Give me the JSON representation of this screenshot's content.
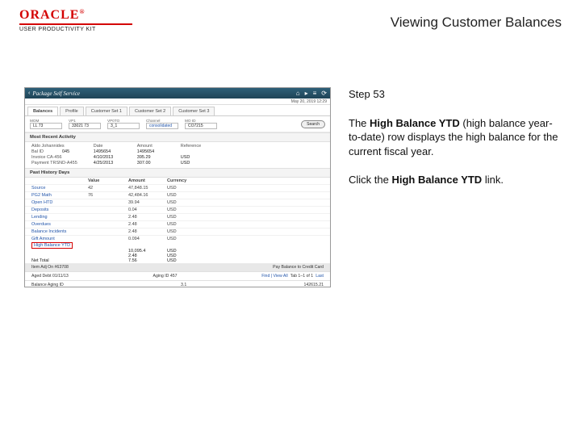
{
  "header": {
    "brand": "ORACLE",
    "brand_reg": "®",
    "kit": "USER PRODUCTIVITY KIT",
    "title": "Viewing Customer Balances"
  },
  "shot": {
    "titlebar": {
      "chevron": "‹",
      "title": "Package Self Service",
      "date_below": "May 20, 2019 12:29"
    },
    "tabs": [
      "Balances",
      "Profile",
      "Customer Set 1",
      "Customer Set 2",
      "Customer Set 3"
    ],
    "filters": {
      "mom": {
        "label": "MOM",
        "value": "LL 73"
      },
      "vp1": {
        "label": "VP1",
        "value": "33021  73"
      },
      "vp0": {
        "label": "VP0TO",
        "value": "3_1"
      },
      "channel": {
        "label": "Channel",
        "value": "consolidated"
      },
      "moid": {
        "label": "MO ID",
        "value": "CO7215"
      },
      "search": "Search"
    },
    "section_recent": "Most Recent Activity",
    "recent_header": {
      "c0": "",
      "c1": "Date",
      "c2": "Amount",
      "c3": "Reference"
    },
    "recent_rows": [
      {
        "c0": "Aldo Johannides",
        "c1": "",
        "c2": "",
        "c3": ""
      },
      {
        "c0": "Bal ID",
        "c1": "045",
        "c2": "",
        "c3": "1495654"
      },
      {
        "c0": "Invoice  CA-456",
        "c1": "4/10/2013",
        "c2": "395.29",
        "c3": "USD"
      },
      {
        "c0": "Payment  TRSND-A455",
        "c1": "4/25/2013",
        "c2": "307.00",
        "c3": "USD"
      }
    ],
    "section_hist": "Past History Days",
    "hist_header": {
      "c0": "",
      "c1": "Value",
      "c2": "Amount",
      "c3": "Currency"
    },
    "hist_rows": [
      {
        "c0": "Source",
        "c1": "42",
        "c2": "47,848.15",
        "c3": "USD"
      },
      {
        "c0": "PG2 Math",
        "c1": "76",
        "c2": "42,484.16",
        "c3": "USD"
      },
      {
        "c0": "Open HTD",
        "c1": "",
        "c2": "39.94",
        "c3": "USD"
      },
      {
        "c0": "Deposits",
        "c1": "",
        "c2": "0.04",
        "c3": "USD"
      },
      {
        "c0": "Lending",
        "c1": "",
        "c2": "2.48",
        "c3": "USD"
      },
      {
        "c0": "Overdues",
        "c1": "",
        "c2": "2.48",
        "c3": "USD"
      },
      {
        "c0": "Balance Incidents",
        "c1": "",
        "c2": "2.48",
        "c3": "USD"
      },
      {
        "c0": "Gift Amount",
        "c1": "",
        "c2": "0.094",
        "c3": "USD"
      }
    ],
    "hibal": {
      "label": "High Balance YTD",
      "v1": "10,095.4",
      "v2": "USD"
    },
    "below_hibal": [
      {
        "c0": "",
        "c1": "",
        "c2": "2.48",
        "c3": "USD"
      },
      {
        "c0": "Net Total",
        "c1": "",
        "c2": "7.56",
        "c3": "USD"
      }
    ],
    "greybar": {
      "left": "Item Adj On  #63708",
      "right": "Pay Balance to Credit Card"
    },
    "footer": {
      "left": "Aged Debt  01/11/13",
      "mid": "Aging ID  457"
    },
    "pager": {
      "find": "Find | View All",
      "count": "Tab 1–1 of 1",
      "last": "Last"
    },
    "lastrow": {
      "l": "Balance Aging ID",
      "m": "3.1",
      "r": "142615.21"
    }
  },
  "instr": {
    "step": "Step 53",
    "p1a": "The ",
    "p1b": "High Balance YTD",
    "p1c": " (high balance year-to-date) row displays the high balance for the current fiscal year.",
    "p2a": "Click the ",
    "p2b": "High Balance YTD",
    "p2c": " link."
  }
}
